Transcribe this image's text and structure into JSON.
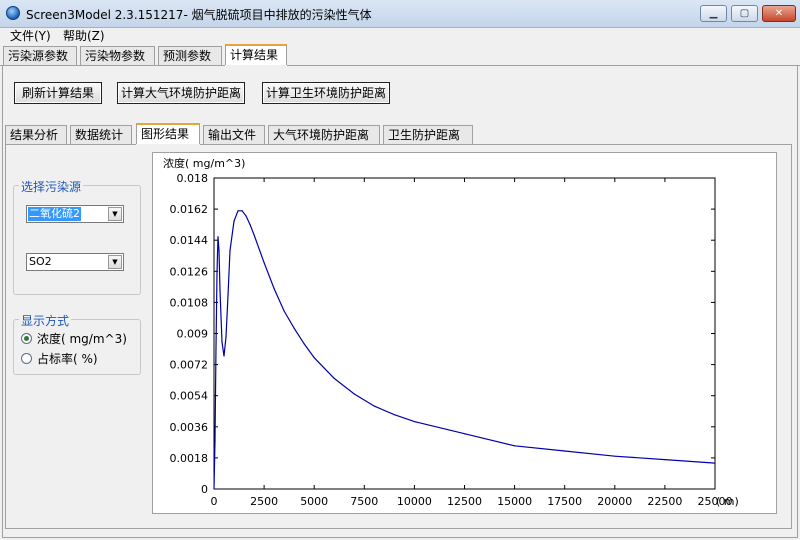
{
  "window": {
    "title": "Screen3Model 2.3.151217- 烟气脱硫项目中排放的污染性气体"
  },
  "menu": {
    "file": "文件(Y)",
    "help": "帮助(Z)"
  },
  "main_tabs": [
    {
      "label": "污染源参数"
    },
    {
      "label": "污染物参数"
    },
    {
      "label": "预测参数"
    },
    {
      "label": "计算结果",
      "active": true
    }
  ],
  "toolbar": {
    "refresh_label": "刷新计算结果",
    "air_label": "计算大气环境防护距离",
    "health_label": "计算卫生环境防护距离"
  },
  "sub_tabs": [
    {
      "label": "结果分析"
    },
    {
      "label": "数据统计"
    },
    {
      "label": "图形结果",
      "active": true
    },
    {
      "label": "输出文件"
    },
    {
      "label": "大气环境防护距离"
    },
    {
      "label": "卫生防护距离"
    }
  ],
  "source_group": {
    "title": "选择污染源",
    "source_value": "二氧化硫2",
    "pollutant_value": "SO2"
  },
  "display_group": {
    "title": "显示方式",
    "options": [
      {
        "label": "浓度( mg/m^3)",
        "checked": true
      },
      {
        "label": "占标率( %)",
        "checked": false
      }
    ]
  },
  "chart_data": {
    "type": "line",
    "ylabel": "浓度( mg/m^3)",
    "xunit": "( m)",
    "xlim": [
      0,
      25000
    ],
    "ylim": [
      0,
      0.018
    ],
    "xticks": [
      "0",
      "2500",
      "5000",
      "7500",
      "10000",
      "12500",
      "15000",
      "17500",
      "20000",
      "22500",
      "25000"
    ],
    "yticks": [
      "0",
      "0.0018",
      "0.0036",
      "0.0054",
      "0.0072",
      "0.009",
      "0.0108",
      "0.0126",
      "0.0144",
      "0.0162",
      "0.018"
    ],
    "line_color": "#0000aa",
    "series": [
      {
        "x": [
          1,
          50,
          100,
          150,
          200,
          250,
          300,
          400,
          500,
          600,
          700,
          800,
          1000,
          1200,
          1400,
          1600,
          1800,
          2000,
          2500,
          3000,
          3500,
          4000,
          4500,
          5000,
          6000,
          7000,
          8000,
          9000,
          10000,
          12500,
          15000,
          17500,
          20000,
          22500,
          25000
        ],
        "y": [
          0.0,
          0.0028,
          0.0082,
          0.0125,
          0.0146,
          0.0138,
          0.0115,
          0.0085,
          0.0077,
          0.0088,
          0.0112,
          0.0138,
          0.0155,
          0.0161,
          0.0161,
          0.0158,
          0.0153,
          0.0147,
          0.0131,
          0.0116,
          0.0103,
          0.0093,
          0.0084,
          0.0076,
          0.0064,
          0.0055,
          0.0048,
          0.0043,
          0.0039,
          0.0032,
          0.0025,
          0.0022,
          0.0019,
          0.0017,
          0.0015
        ]
      }
    ]
  }
}
